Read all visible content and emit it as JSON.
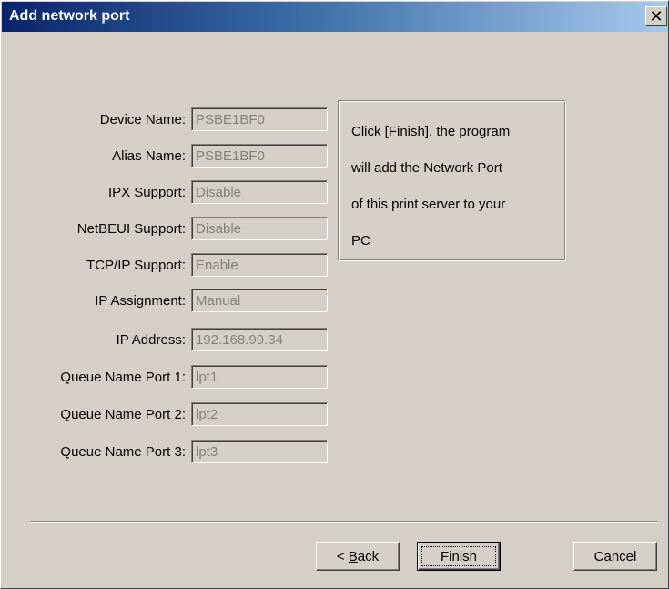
{
  "window": {
    "title": "Add network port",
    "close_glyph": "✕"
  },
  "fields": [
    {
      "label": "Device Name:",
      "value": "PSBE1BF0"
    },
    {
      "label": "Alias Name:",
      "value": "PSBE1BF0"
    },
    {
      "label": "IPX Support:",
      "value": "Disable"
    },
    {
      "label": "NetBEUI Support:",
      "value": "Disable"
    },
    {
      "label": "TCP/IP Support:",
      "value": "Enable"
    },
    {
      "label": "IP Assignment:",
      "value": "Manual"
    },
    {
      "label": "IP Address:",
      "value": "192.168.99.34"
    },
    {
      "label": "Queue Name Port 1:",
      "value": "lpt1"
    },
    {
      "label": "Queue Name Port 2:",
      "value": "lpt2"
    },
    {
      "label": "Queue Name Port 3:",
      "value": "lpt3"
    }
  ],
  "info": {
    "line1": "Click [Finish], the program",
    "line2": "will add the Network Port",
    "line3": "of this print server to your",
    "line4": "PC"
  },
  "buttons": {
    "back_prefix": "< ",
    "back_mnemonic": "B",
    "back_rest": "ack",
    "finish": "Finish",
    "cancel": "Cancel"
  },
  "colors": {
    "title_gradient_start": "#0a246a",
    "title_gradient_end": "#a6caf0",
    "dialog_face": "#d4d0c8",
    "disabled_text": "#808080"
  }
}
